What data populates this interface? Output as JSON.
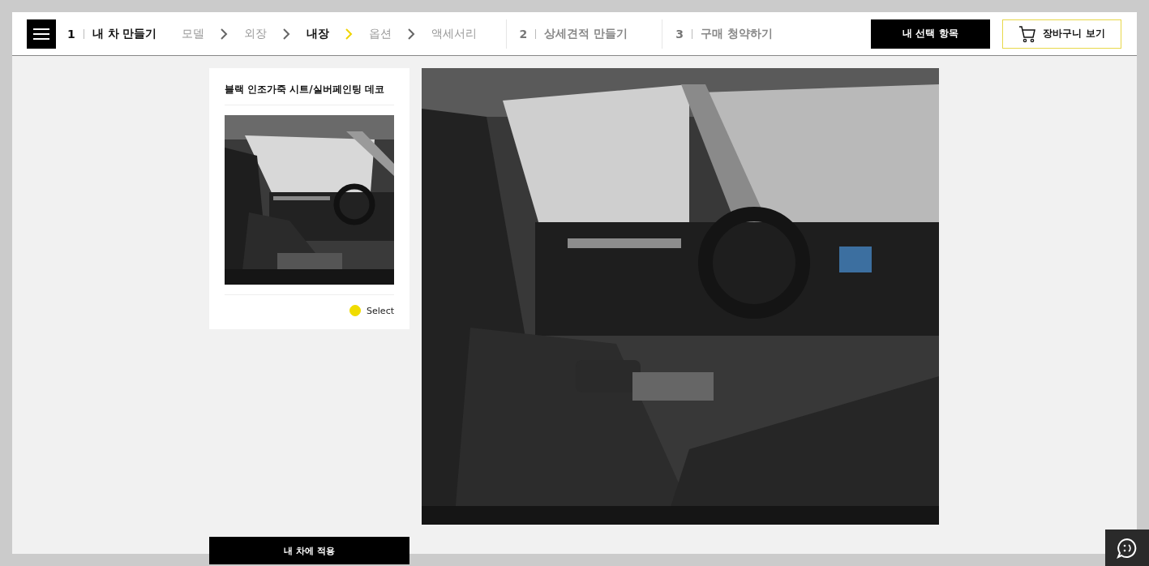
{
  "header": {
    "steps": [
      {
        "number": "1",
        "label": "내 차 만들기",
        "selected": true,
        "items": [
          {
            "label": "모델",
            "selected": false
          },
          {
            "label": "외장",
            "selected": false
          },
          {
            "label": "내장",
            "selected": true
          },
          {
            "label": "옵션",
            "selected": false
          },
          {
            "label": "액세서리",
            "selected": false
          }
        ]
      },
      {
        "number": "2",
        "label": "상세견적 만들기",
        "selected": false
      },
      {
        "number": "3",
        "label": "구매 청약하기",
        "selected": false
      }
    ],
    "my_selection_button": "내 선택 항목",
    "cart_button": "장바구니 보기"
  },
  "option_card": {
    "title": "블랙 인조가죽 시트/실버페인팅 데코",
    "select_label": "Select",
    "selected": true
  },
  "apply_button": "내 차에 적용"
}
